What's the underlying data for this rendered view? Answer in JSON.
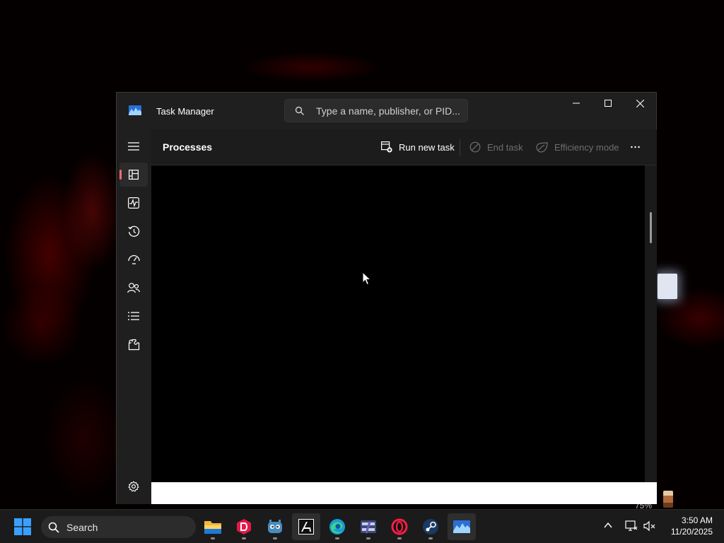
{
  "window": {
    "title": "Task Manager",
    "icon": "task-manager-icon",
    "search_placeholder": "Type a name, publisher, or PID...",
    "controls": [
      "minimize-icon",
      "maximize-icon",
      "close-icon"
    ]
  },
  "sidebar": {
    "items": [
      {
        "icon": "hamburger-menu-icon"
      },
      {
        "icon": "processes-icon",
        "active": true
      },
      {
        "icon": "performance-icon"
      },
      {
        "icon": "app-history-icon"
      },
      {
        "icon": "startup-apps-icon"
      },
      {
        "icon": "users-icon"
      },
      {
        "icon": "details-icon"
      },
      {
        "icon": "services-icon"
      },
      {
        "icon": "settings-icon"
      }
    ]
  },
  "toolbar": {
    "page_title": "Processes",
    "run_new_task": "Run new task",
    "end_task": "End task",
    "efficiency_mode": "Efficiency mode",
    "more": "more-options-icon"
  },
  "desktop": {
    "partial_text": "75%"
  },
  "taskbar": {
    "search_label": "Search",
    "apps": [
      "file-explorer-icon",
      "davinci-resolve-icon",
      "godot-icon",
      "autodesk-icon",
      "edge-icon",
      "winrar-icon",
      "opera-gx-icon",
      "steam-icon",
      "task-manager-icon"
    ],
    "time": "3:50 AM",
    "date": "11/20/2025"
  },
  "colors": {
    "accent": "#ff6b6b",
    "window_bg": "#1c1c1c",
    "taskbar_bg": "#1b1b1b"
  }
}
